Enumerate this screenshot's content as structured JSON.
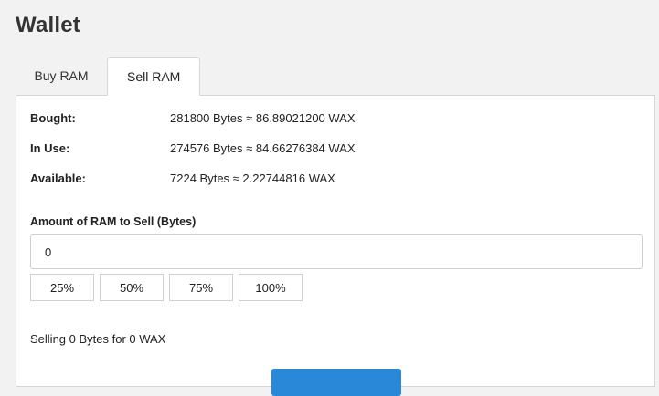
{
  "page": {
    "title": "Wallet"
  },
  "tabs": [
    {
      "label": "Buy RAM",
      "active": false
    },
    {
      "label": "Sell RAM",
      "active": true
    }
  ],
  "ram_info": {
    "bought": {
      "label": "Bought:",
      "value": "281800 Bytes ≈ 86.89021200 WAX"
    },
    "in_use": {
      "label": "In Use:",
      "value": "274576 Bytes ≈ 84.66276384 WAX"
    },
    "available": {
      "label": "Available:",
      "value": "7224 Bytes ≈ 2.22744816 WAX"
    }
  },
  "sell_form": {
    "amount_label": "Amount of RAM to Sell (Bytes)",
    "amount_value": "0",
    "percent_buttons": [
      "25%",
      "50%",
      "75%",
      "100%"
    ],
    "summary": "Selling 0 Bytes for 0 WAX"
  },
  "colors": {
    "accent": "#2a88d8"
  }
}
